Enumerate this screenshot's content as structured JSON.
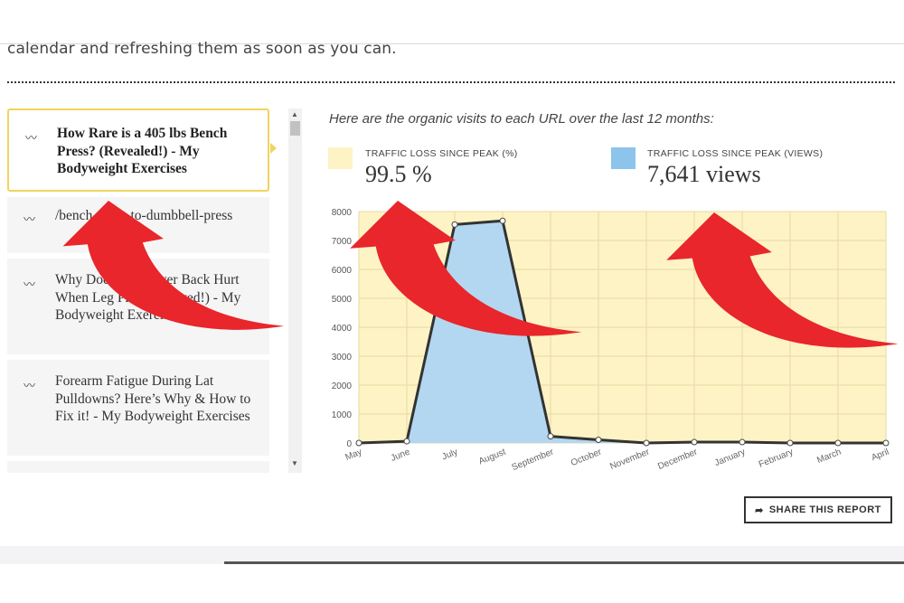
{
  "intro_text": "calendar and refreshing them as soon as you can.",
  "url_list": {
    "icon": "trend-line-icon",
    "items": [
      {
        "label": "How Rare is a 405 lbs Bench Press? (Revealed!) - My Bodyweight Exercises"
      },
      {
        "label": "/bench-press-to-dumbbell-press"
      },
      {
        "label": "Why Does My Lower Back Hurt When Leg Press? (Solved!) - My Bodyweight Exercises"
      },
      {
        "label": "Forearm Fatigue During Lat Pulldowns? Here’s Why & How to Fix it! - My Bodyweight Exercises"
      }
    ]
  },
  "report": {
    "heading": "Here are the organic visits to each URL over the last 12 months:",
    "loss_pct_label": "TRAFFIC LOSS SINCE PEAK (%)",
    "loss_pct_value": "99.5 %",
    "loss_views_label": "TRAFFIC LOSS SINCE PEAK (VIEWS)",
    "loss_views_value": "7,641 views",
    "share_label": "SHARE THIS REPORT",
    "share_icon": "share-arrow-icon"
  },
  "colors": {
    "pct_swatch": "#fdf3c4",
    "views_swatch": "#8cc4ec",
    "area_fill": "#b3d7f0",
    "plot_bg": "#fdf3c4",
    "line": "#333333",
    "arrow": "#e8262b",
    "accent_border": "#f2d35e"
  },
  "chart_data": {
    "type": "area",
    "categories": [
      "May",
      "June",
      "July",
      "August",
      "September",
      "October",
      "November",
      "December",
      "January",
      "February",
      "March",
      "April"
    ],
    "series": [
      {
        "values": [
          0,
          60,
          7550,
          7680,
          230,
          110,
          0,
          30,
          30,
          0,
          0,
          0
        ]
      }
    ],
    "ylim": [
      0,
      8000
    ],
    "yticks": [
      0,
      1000,
      2000,
      3000,
      4000,
      5000,
      6000,
      7000,
      8000
    ],
    "grid": true,
    "legend": "none"
  }
}
